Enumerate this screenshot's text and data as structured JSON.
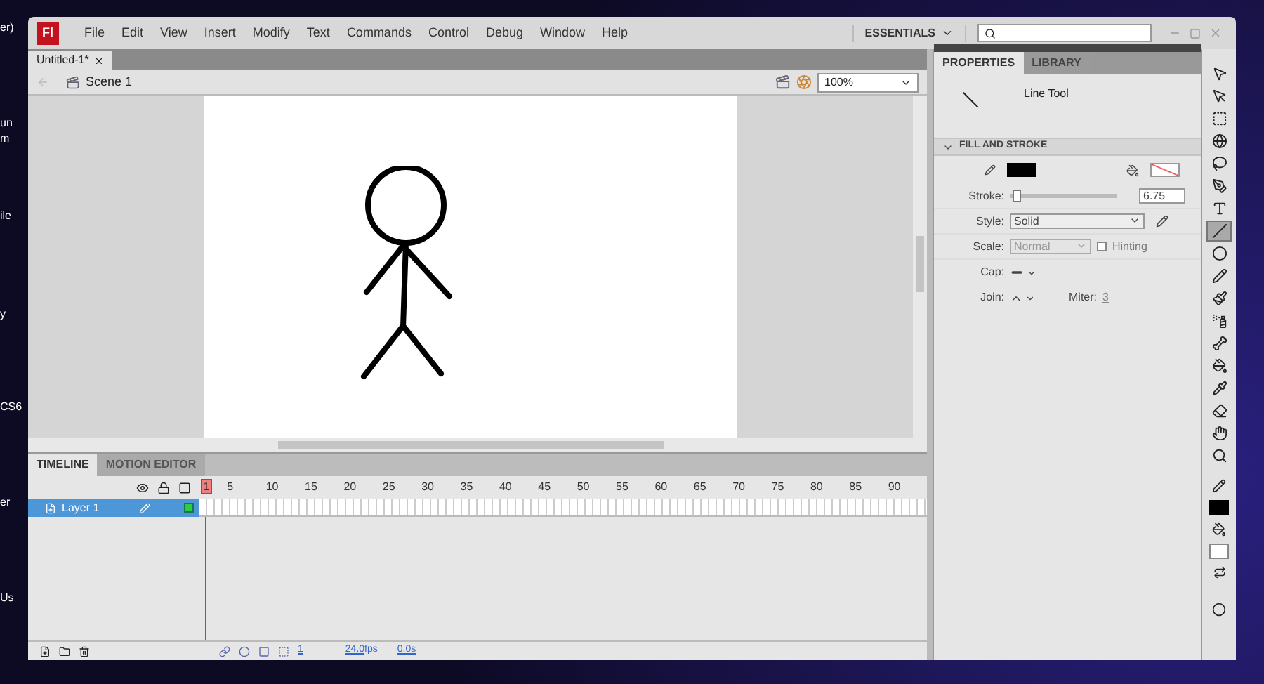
{
  "desktop_labels": [
    "er)",
    "un",
    "m",
    "ile",
    "y",
    "CS6",
    "er",
    "Us"
  ],
  "app_logo": "Fl",
  "menu": [
    "File",
    "Edit",
    "View",
    "Insert",
    "Modify",
    "Text",
    "Commands",
    "Control",
    "Debug",
    "Window",
    "Help"
  ],
  "workspace": {
    "label": "ESSENTIALS"
  },
  "document_tabs": [
    {
      "label": "Untitled-1*",
      "selected": true
    }
  ],
  "breadcrumb": {
    "scene": "Scene 1"
  },
  "zoom": {
    "value": "100%"
  },
  "properties": {
    "tabs": [
      {
        "label": "PROPERTIES",
        "selected": true
      },
      {
        "label": "LIBRARY",
        "selected": false
      }
    ],
    "tool_name": "Line Tool",
    "section": {
      "title": "FILL AND STROKE",
      "expanded": true
    },
    "stroke": {
      "label": "Stroke:",
      "level": 0.03,
      "value": "6.75"
    },
    "style": {
      "label": "Style:",
      "value": "Solid"
    },
    "scale": {
      "label": "Scale:",
      "value": "Normal",
      "disabled": true
    },
    "hinting": {
      "label": "Hinting",
      "checked": false
    },
    "cap": {
      "label": "Cap:"
    },
    "join": {
      "label": "Join:"
    },
    "miter": {
      "label": "Miter:",
      "value": "3"
    }
  },
  "timeline": {
    "tabs": [
      {
        "label": "TIMELINE",
        "selected": true
      },
      {
        "label": "MOTION EDITOR",
        "selected": false
      }
    ],
    "frame_numbers": [
      "1",
      "5",
      "10",
      "15",
      "20",
      "25",
      "30",
      "35",
      "40",
      "45",
      "50",
      "55",
      "60",
      "65",
      "70",
      "75",
      "80",
      "85",
      "90"
    ],
    "layers": [
      {
        "name": "Layer 1",
        "selected": true
      }
    ],
    "current_frame": "1",
    "fps": "24.0",
    "fps_unit": "fps",
    "time": "0.0s"
  },
  "tools": [
    {
      "kind": "selection",
      "selected": false
    },
    {
      "kind": "subselection",
      "selected": false
    },
    {
      "kind": "transform",
      "selected": false
    },
    {
      "kind": "rotate3d",
      "selected": false
    },
    {
      "kind": "lasso",
      "selected": false
    },
    {
      "kind": "pen",
      "selected": false
    },
    {
      "kind": "text",
      "selected": false
    },
    {
      "kind": "line",
      "selected": true
    },
    {
      "kind": "oval",
      "selected": false
    },
    {
      "kind": "pencil",
      "selected": false
    },
    {
      "kind": "brush",
      "selected": false
    },
    {
      "kind": "deco",
      "selected": false
    },
    {
      "kind": "bone",
      "selected": false
    },
    {
      "kind": "bucket",
      "selected": false
    },
    {
      "kind": "eyedropper",
      "selected": false
    },
    {
      "kind": "eraser",
      "selected": false
    },
    {
      "kind": "hand",
      "selected": false
    },
    {
      "kind": "zoom",
      "selected": false
    }
  ]
}
